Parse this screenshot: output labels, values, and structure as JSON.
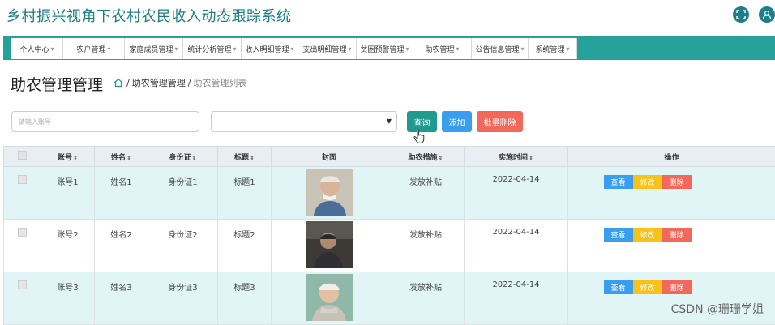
{
  "app": {
    "title": "乡村振兴视角下农村农民收入动态跟踪系统"
  },
  "top_icons": [
    "expand-icon",
    "user-icon"
  ],
  "nav": {
    "items": [
      {
        "label": "个人中心"
      },
      {
        "label": "农户管理"
      },
      {
        "label": "家庭成员管理"
      },
      {
        "label": "统计分析管理"
      },
      {
        "label": "收入明细管理"
      },
      {
        "label": "支出明细管理"
      },
      {
        "label": "贫困预警管理"
      },
      {
        "label": "助农管理"
      },
      {
        "label": "公告信息管理"
      },
      {
        "label": "系统管理"
      }
    ]
  },
  "page": {
    "title": "助农管理管理",
    "breadcrumb": {
      "parent": "助农管理管理",
      "separator": "/",
      "current": "助农管理列表"
    }
  },
  "search": {
    "placeholder": "请输入账号",
    "select_value": "",
    "query_label": "查询",
    "add_label": "添加",
    "batch_delete_label": "批量删除"
  },
  "table": {
    "headers": {
      "account": "账号",
      "name": "姓名",
      "idcard": "身份证",
      "title": "标题",
      "cover": "封面",
      "measure": "助农措施",
      "date": "实施时间",
      "ops": "操作"
    },
    "rows": [
      {
        "account": "账号1",
        "name": "姓名1",
        "idcard": "身份证1",
        "title": "标题1",
        "measure": "发放补贴",
        "date": "2022-04-14"
      },
      {
        "account": "账号2",
        "name": "姓名2",
        "idcard": "身份证2",
        "title": "标题2",
        "measure": "发放补贴",
        "date": "2022-04-14"
      },
      {
        "account": "账号3",
        "name": "姓名3",
        "idcard": "身份证3",
        "title": "标题3",
        "measure": "发放补贴",
        "date": "2022-04-14"
      }
    ],
    "actions": {
      "view": "查看",
      "edit": "修改",
      "delete": "删除"
    }
  },
  "colors": {
    "accent": "#25a09a",
    "title": "#1e7e88",
    "view": "#3a9ef0",
    "edit": "#f7c21a",
    "delete": "#f2685a",
    "row_alt": "#e2f5f6"
  },
  "watermark": "CSDN @珊珊学姐"
}
